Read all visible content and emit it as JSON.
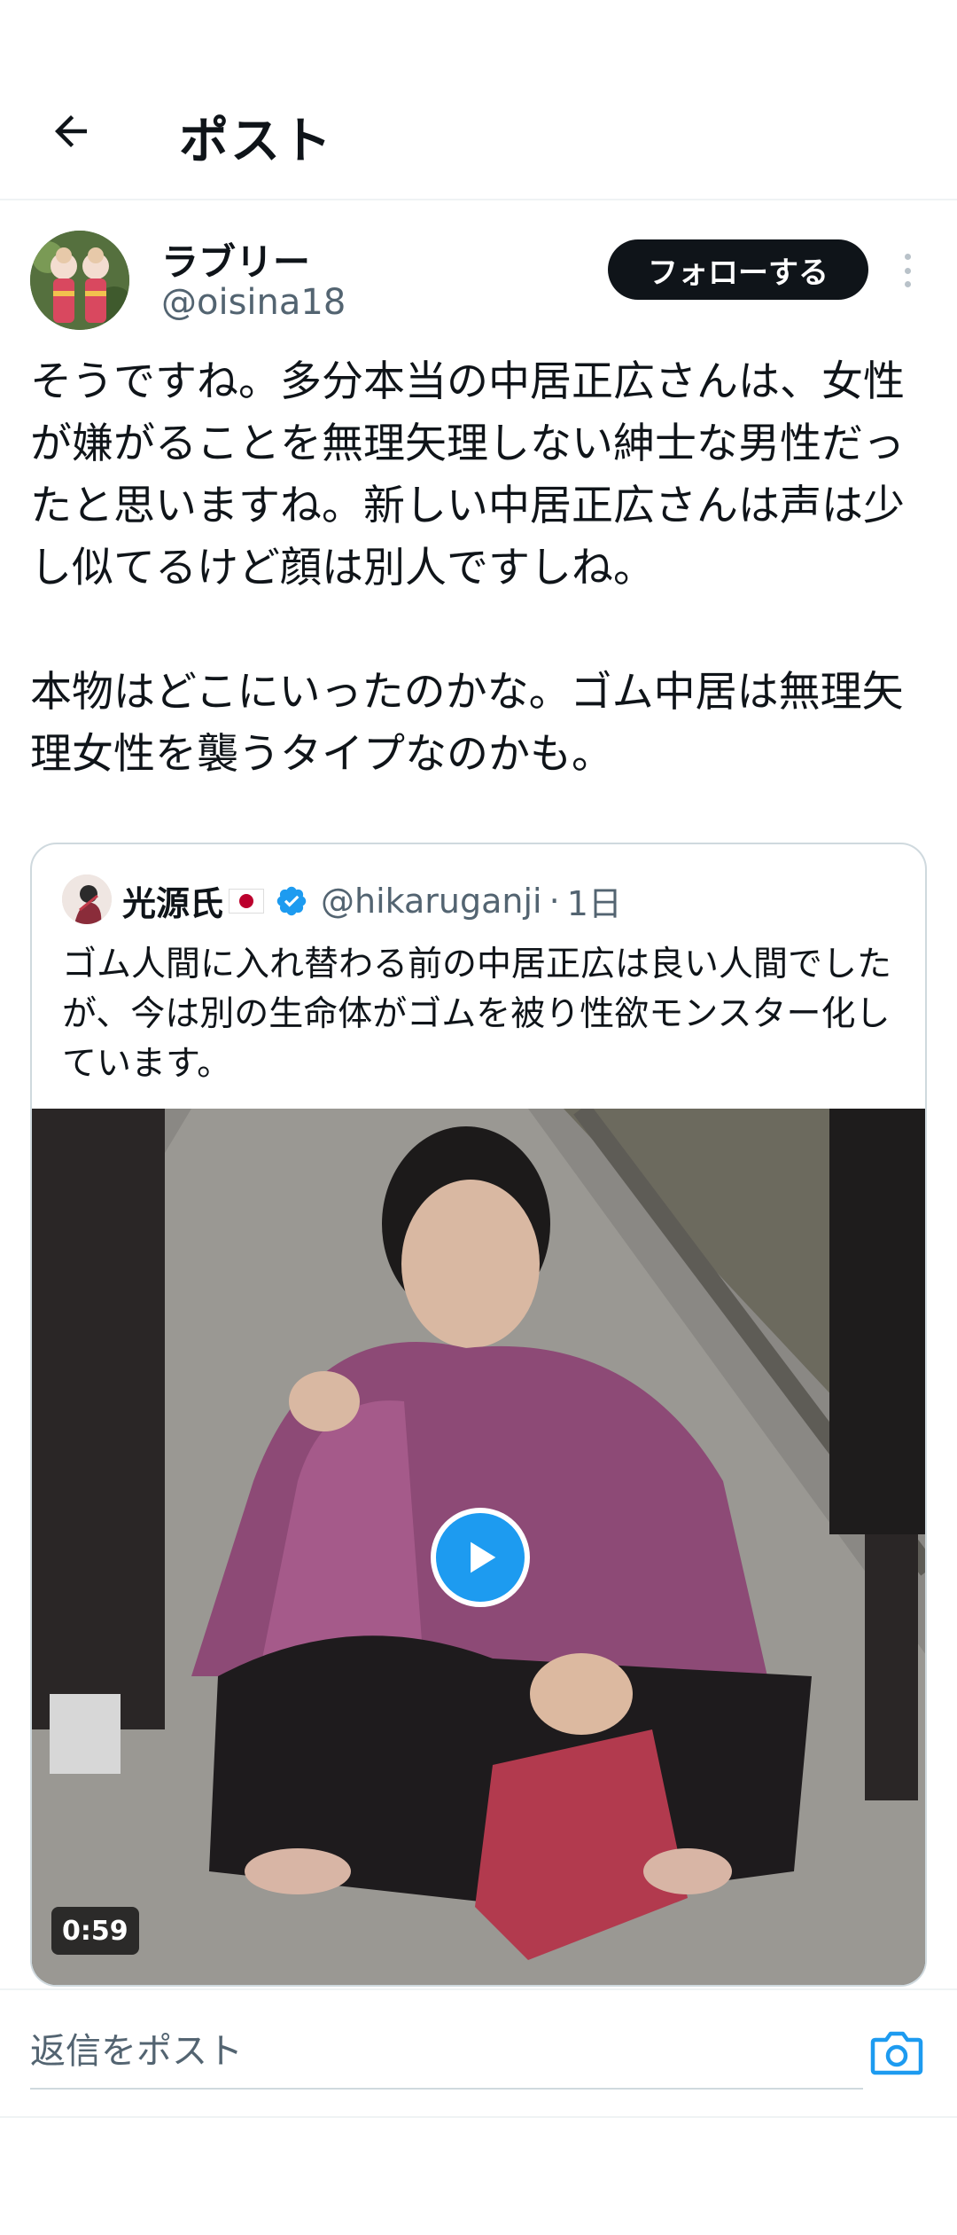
{
  "header": {
    "title": "ポスト"
  },
  "post": {
    "display_name": "ラブリー",
    "handle": "@oisina18",
    "follow_label": "フォローする",
    "text": "そうですね。多分本当の中居正広さんは、女性が嫌がることを無理矢理しない紳士な男性だったと思いますね。新しい中居正広さんは声は少し似てるけど顔は別人ですしね。\n\n本物はどこにいったのかな。ゴム中居は無理矢理女性を襲うタイプなのかも。"
  },
  "quote": {
    "name": "光源氏",
    "handle": "@hikaruganji",
    "separator": "·",
    "time": "1日",
    "text": "ゴム人間に入れ替わる前の中居正広は良い人間でしたが、今は別の生命体がゴムを被り性欲モンスター化しています。",
    "video_duration": "0:59"
  },
  "reply": {
    "placeholder": "返信をポスト"
  },
  "colors": {
    "accent": "#1d9bf0",
    "text": "#0f1419",
    "secondary": "#536471"
  }
}
